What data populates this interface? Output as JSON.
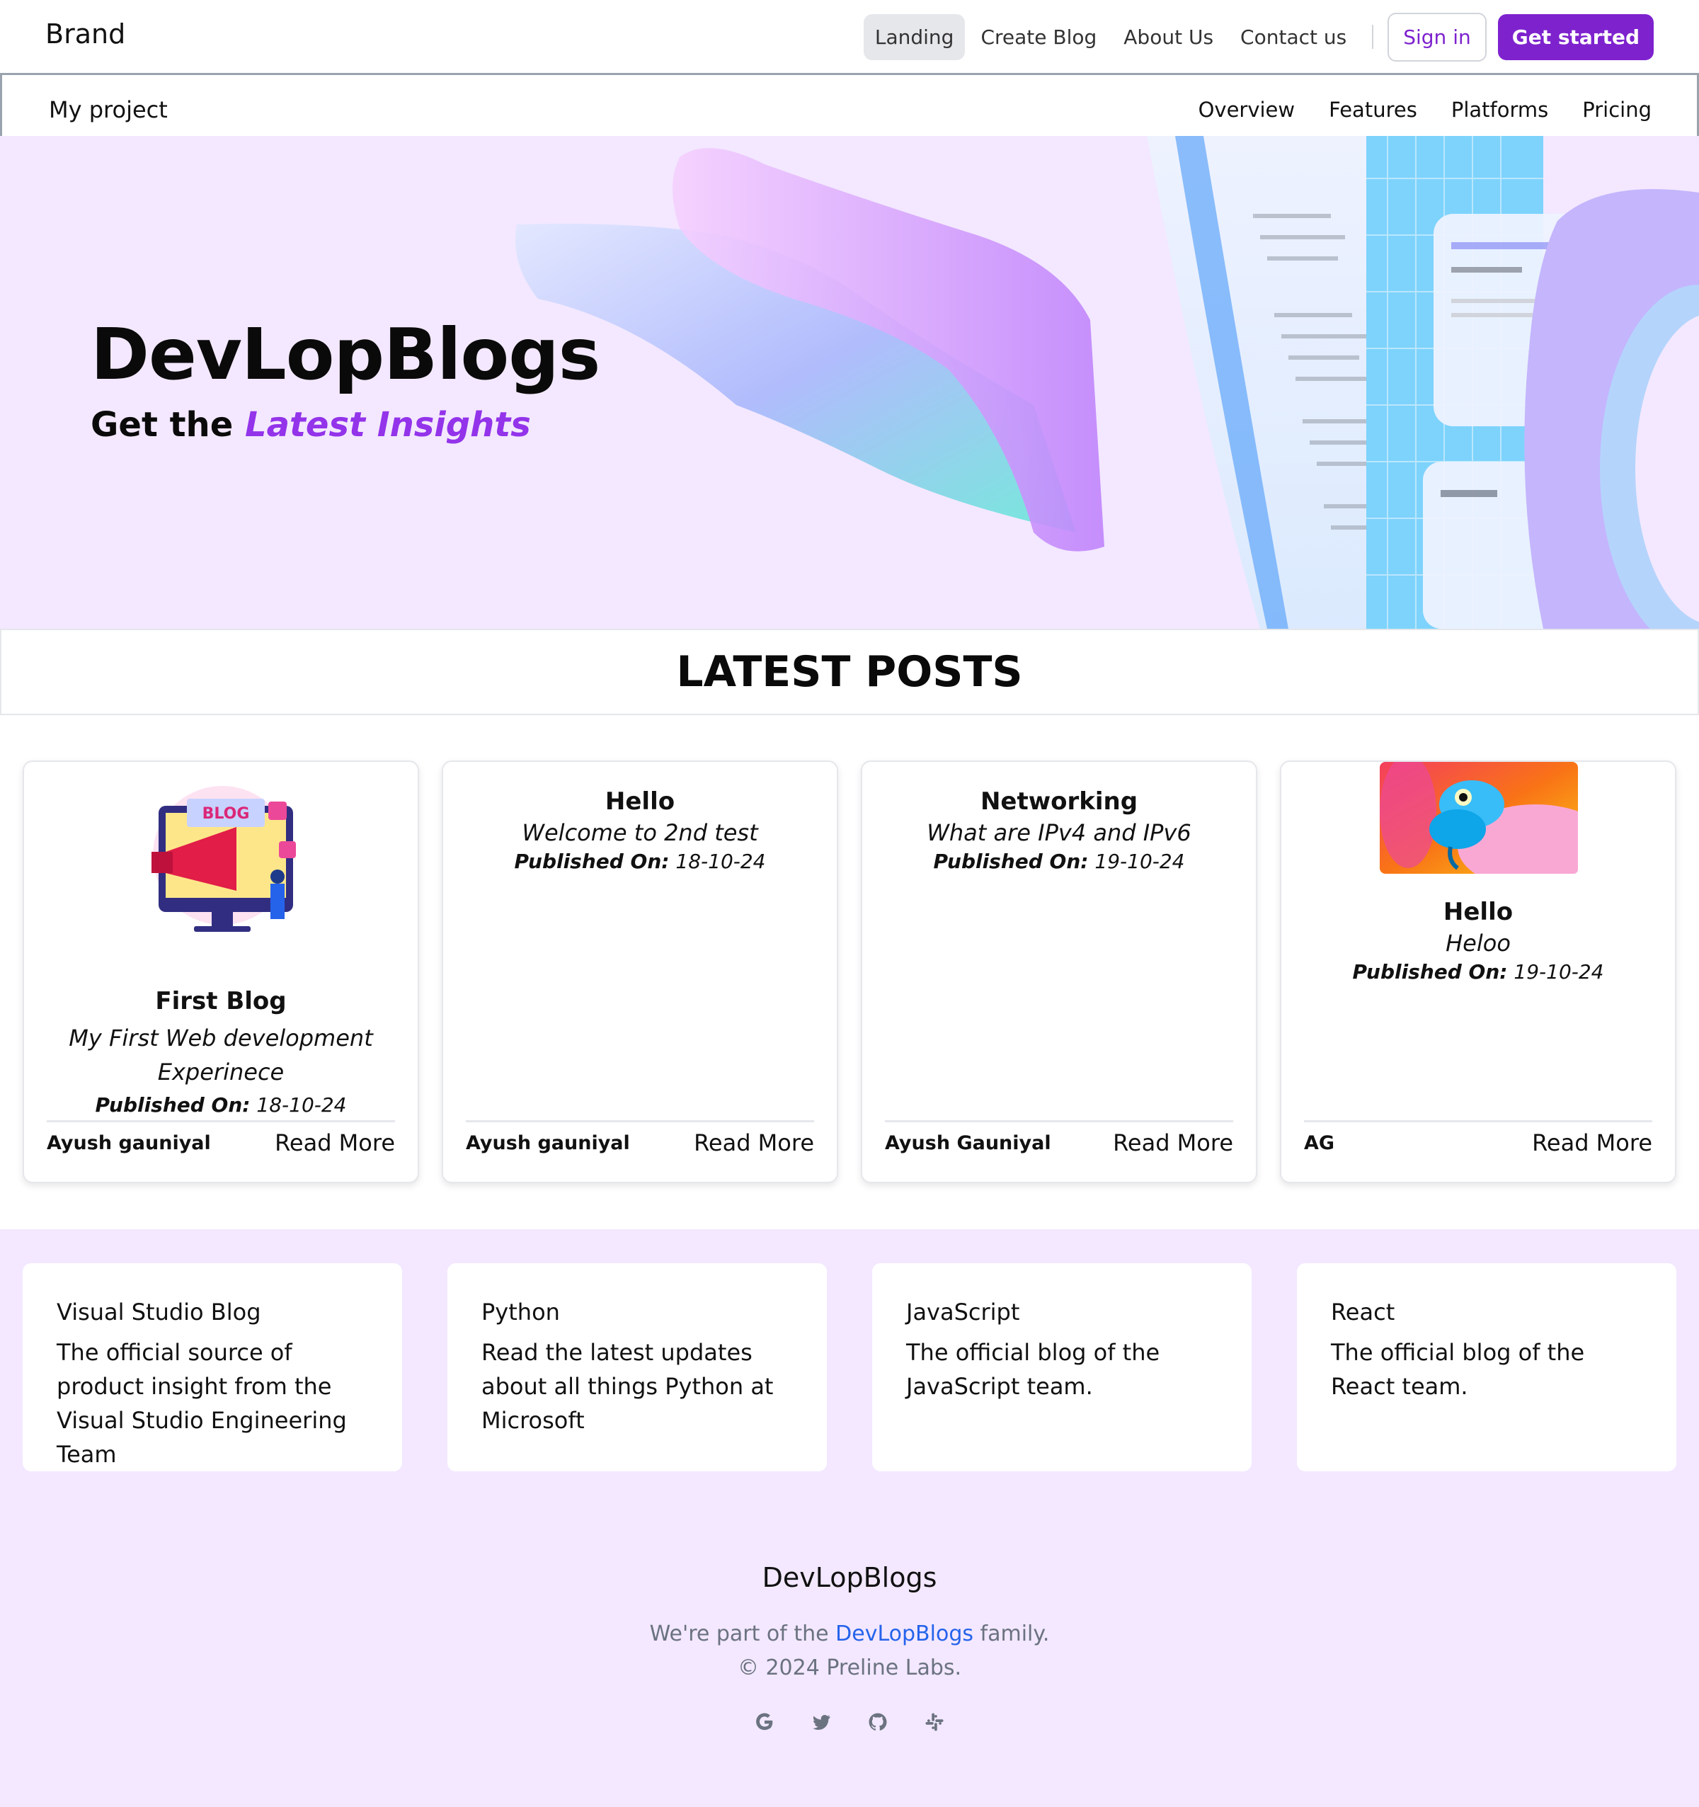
{
  "header": {
    "brand": "Brand",
    "nav": [
      "Landing",
      "Create Blog",
      "About Us",
      "Contact us"
    ],
    "sign_in": "Sign in",
    "get_started": "Get started"
  },
  "subnav": {
    "project": "My project",
    "links": [
      "Overview",
      "Features",
      "Platforms",
      "Pricing"
    ]
  },
  "hero": {
    "title": "DevLopBlogs",
    "subtitle_prefix": "Get the ",
    "subtitle_highlight": "Latest Insights"
  },
  "latest": {
    "heading": "LATEST POSTS"
  },
  "posts": [
    {
      "title": "First Blog",
      "desc": "My First Web development Experinece",
      "published_label": "Published On:",
      "date": "18-10-24",
      "author": "Ayush gauniyal",
      "read_more": "Read More"
    },
    {
      "title": "Hello",
      "desc": "Welcome to 2nd test",
      "published_label": "Published On:",
      "date": "18-10-24",
      "author": "Ayush gauniyal",
      "read_more": "Read More"
    },
    {
      "title": "Networking",
      "desc": "What are IPv4 and IPv6",
      "published_label": "Published On:",
      "date": "19-10-24",
      "author": "Ayush Gauniyal",
      "read_more": "Read More"
    },
    {
      "title": "Hello",
      "desc": "Heloo",
      "published_label": "Published On:",
      "date": "19-10-24",
      "author": "AG",
      "read_more": "Read More"
    }
  ],
  "blogs": [
    {
      "name": "Visual Studio Blog",
      "text": "The official source of product insight from the Visual Studio Engineering Team"
    },
    {
      "name": "Python",
      "text": "Read the latest updates about all things Python at Microsoft"
    },
    {
      "name": "JavaScript",
      "text": "The official blog of the JavaScript team."
    },
    {
      "name": "React",
      "text": "The official blog of the React team."
    }
  ],
  "footer": {
    "title": "DevLopBlogs",
    "line1_prefix": "We're part of the ",
    "line1_link": "DevLopBlogs",
    "line1_suffix": " family.",
    "copyright": "© 2024 Preline Labs.",
    "socials": [
      "google-icon",
      "twitter-icon",
      "github-icon",
      "slack-icon"
    ]
  },
  "colors": {
    "accent": "#7e22ce",
    "hero_bg": "#f3e8ff",
    "highlight": "#9333ea",
    "link": "#2563eb"
  }
}
